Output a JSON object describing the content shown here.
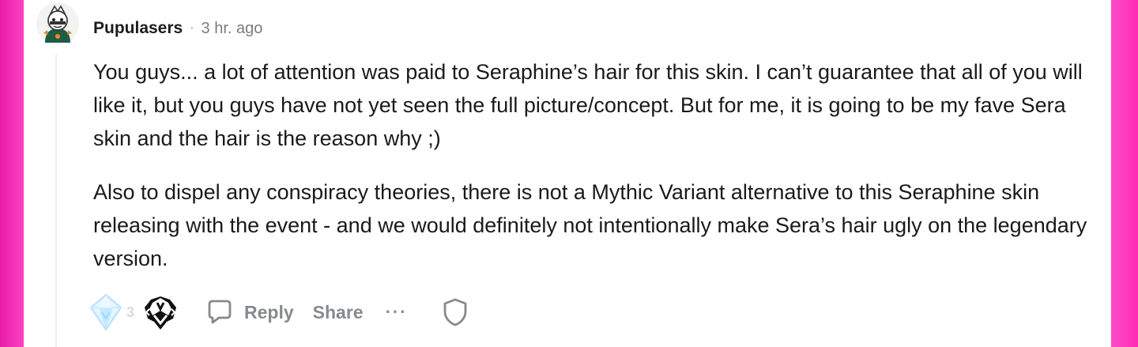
{
  "comment": {
    "author": "Pupulasers",
    "separator": "·",
    "time": "3 hr. ago",
    "paragraphs": [
      "You guys... a lot of attention was paid to Seraphine’s hair for this skin. I can’t guarantee that all of you will like it, but you guys have not yet seen the full picture/concept. But for me, it is going to be my fave Sera skin and the hair is the reason why ;)",
      "Also to dispel any conspiracy theories, there is not a Mythic Variant alternative to this Seraphine skin releasing with the event - and we would definitely not intentionally make Sera’s hair ugly on the legendary version."
    ]
  },
  "actions": {
    "award_count": "3",
    "reply_label": "Reply",
    "share_label": "Share",
    "more_label": "···"
  },
  "icons": {
    "avatar": "user-avatar",
    "award_gem": "gem-award-icon",
    "award_crest": "crest-award-icon",
    "reply": "comment-bubble-icon",
    "more": "more-options-icon",
    "shield": "shield-icon"
  },
  "colors": {
    "background": "#ffffff",
    "text": "#1a1a1b",
    "muted": "#878a8c",
    "accent_pink": "#ff3cbd"
  }
}
